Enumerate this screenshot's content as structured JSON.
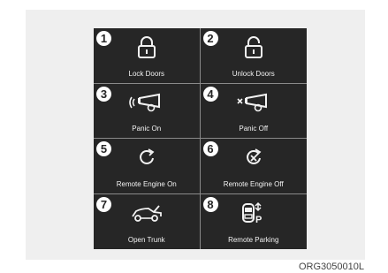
{
  "buttons": [
    {
      "number": "1",
      "label": "Lock Doors",
      "icon": "lock-closed-icon"
    },
    {
      "number": "2",
      "label": "Unlock Doors",
      "icon": "lock-open-icon"
    },
    {
      "number": "3",
      "label": "Panic On",
      "icon": "horn-sound-icon"
    },
    {
      "number": "4",
      "label": "Panic Off",
      "icon": "horn-muted-icon"
    },
    {
      "number": "5",
      "label": "Remote Engine On",
      "icon": "engine-start-icon"
    },
    {
      "number": "6",
      "label": "Remote Engine Off",
      "icon": "engine-stop-icon"
    },
    {
      "number": "7",
      "label": "Open Trunk",
      "icon": "car-trunk-icon"
    },
    {
      "number": "8",
      "label": "Remote Parking",
      "icon": "remote-parking-icon"
    }
  ],
  "caption": "ORG3050010L",
  "colors": {
    "panel": "#262626",
    "divider": "#8a8a8a",
    "text": "#f2f2f2",
    "badge": "#ffffff"
  }
}
